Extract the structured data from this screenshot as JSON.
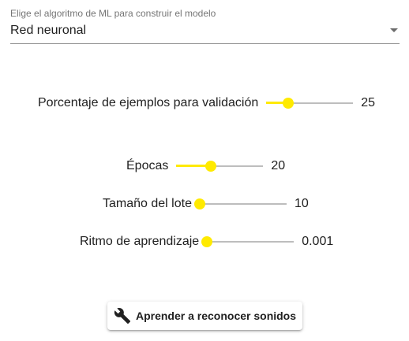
{
  "model_select": {
    "label": "Elige el algoritmo de ML para construir el modelo",
    "value": "Red neuronal"
  },
  "settings": {
    "validation": {
      "label": "Porcentaje de ejemplos para validación",
      "value": "25",
      "fill_fraction": 0.25
    },
    "epochs": {
      "label": "Épocas",
      "value": "20",
      "fill_fraction": 0.4
    },
    "batch_size": {
      "label": "Tamaño del lote",
      "value": "10",
      "fill_fraction": 0.0
    },
    "learning_rate": {
      "label": "Ritmo de aprendizaje",
      "value": "0.001",
      "fill_fraction": 0.0
    }
  },
  "colors": {
    "accent": "#ffea00",
    "track": "#bdbdbd"
  },
  "train_button": {
    "label": "Aprender a reconocer sonidos",
    "icon": "wrench-icon"
  }
}
